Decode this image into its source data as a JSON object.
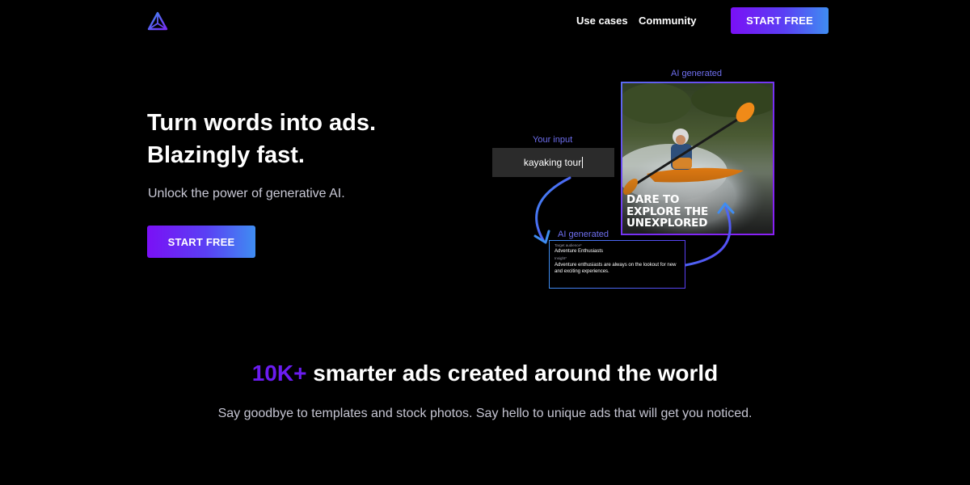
{
  "nav": {
    "logo": "logo-icon",
    "links": [
      "Use cases",
      "Community"
    ],
    "cta": "START FREE"
  },
  "hero": {
    "title_line1": "Turn words into ads.",
    "title_line2": "Blazingly fast.",
    "subtitle": "Unlock the power of generative AI.",
    "cta": "START FREE"
  },
  "demo": {
    "ai_generated_top": "AI generated",
    "your_input_label": "Your input",
    "input_value": "kayaking tour",
    "ad_text": [
      "DARE TO",
      "EXPLORE THE",
      "UNEXPLORED"
    ],
    "ai_generated_bottom": "AI generated",
    "card": {
      "target_label": "Target audience*",
      "target_value": "Adventure Enthusiasts",
      "insight_label": "Insight*",
      "insight_value": "Adventure enthusiasts are always on the lookout for new and exciting experiences."
    }
  },
  "stats": {
    "highlight": "10K+",
    "title_rest": " smarter ads created around the world",
    "subtitle": "Say goodbye to templates and stock photos. Say hello to unique ads that will get you noticed."
  },
  "colors": {
    "background": "#000000",
    "accent_purple": "#7a10f5",
    "accent_blue": "#3f8df2",
    "label_blue": "#6f6ff0"
  }
}
